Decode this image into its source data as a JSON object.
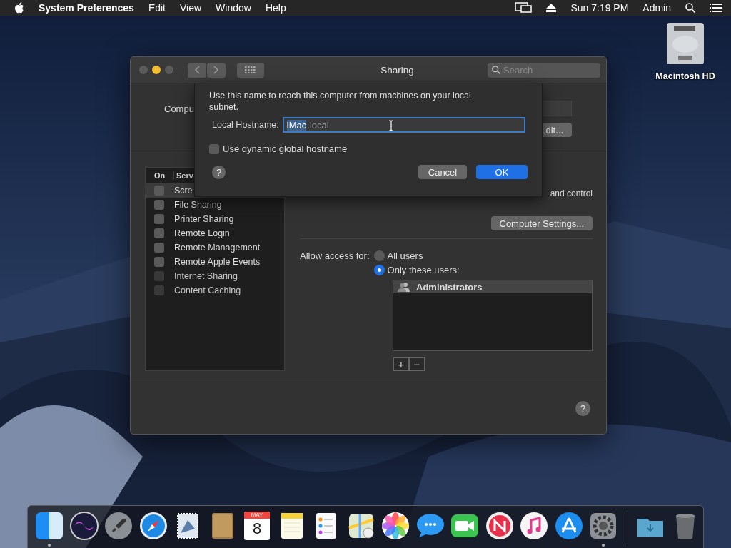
{
  "menu_bar": {
    "app": "System Preferences",
    "menus": [
      "Edit",
      "View",
      "Window",
      "Help"
    ],
    "clock": "Sun 7:19 PM",
    "user": "Admin"
  },
  "desktop_icons": [
    {
      "label": "Macintosh HD"
    }
  ],
  "window": {
    "title": "Sharing",
    "search": {
      "placeholder": "Search"
    },
    "computer_name_label": "Compu",
    "edit_button": "dit...",
    "services": {
      "columns": [
        "On",
        "Serv"
      ],
      "rows": [
        {
          "name": "Scre",
          "checked": false,
          "disabled": false,
          "selected": true
        },
        {
          "name": "File Sharing",
          "checked": false,
          "disabled": false,
          "selected": false
        },
        {
          "name": "Printer Sharing",
          "checked": false,
          "disabled": false,
          "selected": false
        },
        {
          "name": "Remote Login",
          "checked": false,
          "disabled": false,
          "selected": false
        },
        {
          "name": "Remote Management",
          "checked": false,
          "disabled": false,
          "selected": false
        },
        {
          "name": "Remote Apple Events",
          "checked": false,
          "disabled": false,
          "selected": false
        },
        {
          "name": "Internet Sharing",
          "checked": false,
          "disabled": true,
          "selected": false
        },
        {
          "name": "Content Caching",
          "checked": false,
          "disabled": true,
          "selected": false
        }
      ]
    },
    "description": "and control",
    "computer_settings_button": "Computer Settings...",
    "access": {
      "label": "Allow access for:",
      "options": [
        {
          "label": "All users",
          "selected": false
        },
        {
          "label": "Only these users:",
          "selected": true
        }
      ],
      "users": [
        {
          "name": "Administrators",
          "selected": true
        }
      ],
      "add_button": "+",
      "remove_button": "−"
    },
    "help_button": "?"
  },
  "sheet": {
    "message": "Use this name to reach this computer from machines on your local subnet.",
    "hostname_label": "Local Hostname:",
    "hostname": {
      "value": "iMac",
      "suffix": ".local",
      "selected": true
    },
    "dynamic_hostname": {
      "label": "Use dynamic global hostname",
      "checked": false
    },
    "help_button": "?",
    "buttons": [
      {
        "label": "Cancel",
        "default": false
      },
      {
        "label": "OK",
        "default": true
      }
    ]
  },
  "dock": {
    "apps": [
      {
        "running": true
      },
      {
        "running": false
      },
      {
        "running": false
      },
      {
        "running": false
      },
      {
        "running": false
      },
      {
        "running": false
      },
      {
        "running": false,
        "month": "MAY",
        "day": "8"
      },
      {
        "running": false
      },
      {
        "running": false
      },
      {
        "running": false
      },
      {
        "running": false
      },
      {
        "running": false
      },
      {
        "running": false
      },
      {
        "running": false
      },
      {
        "running": false
      },
      {
        "running": false
      },
      {
        "running": true
      }
    ],
    "others": [
      {
        "running": false
      },
      {
        "running": false
      }
    ]
  }
}
